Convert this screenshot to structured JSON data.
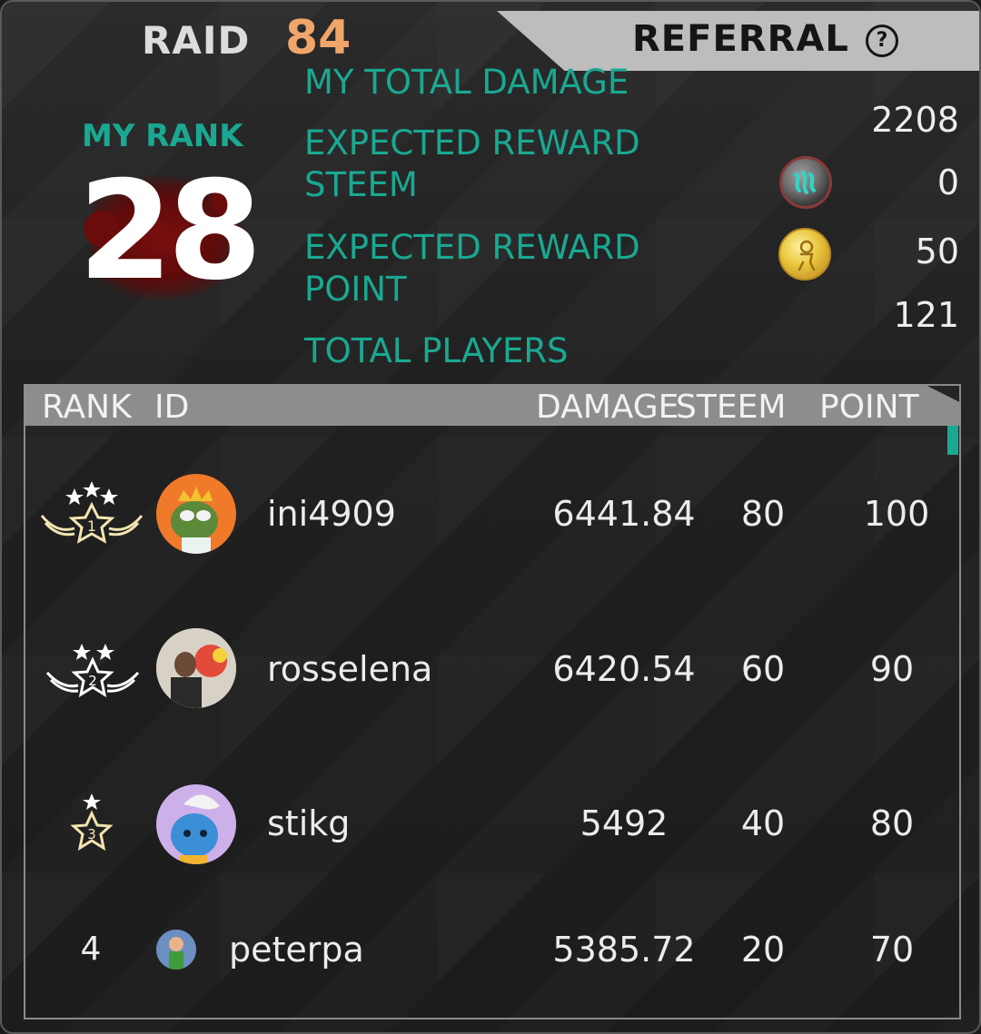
{
  "tabs": {
    "raid_label": "RAID",
    "raid_count": "84",
    "referral_label": "REFERRAL",
    "help_icon": "?"
  },
  "my_rank": {
    "label": "MY RANK",
    "value": "28"
  },
  "stats": {
    "total_damage_label": "MY TOTAL DAMAGE",
    "total_damage_value": "2208",
    "reward_steem_label_1": "EXPECTED REWARD",
    "reward_steem_label_2": "STEEM",
    "reward_steem_value": "0",
    "reward_point_label_1": "EXPECTED REWARD",
    "reward_point_label_2": "POINT",
    "reward_point_value": "50",
    "total_players_label": "TOTAL PLAYERS",
    "total_players_value": "121"
  },
  "icons": {
    "steem": "steem-coin-icon",
    "point": "point-coin-icon"
  },
  "colors": {
    "accent_teal": "#1aa892",
    "raid_orange": "#f0a66a",
    "header_gray": "#8d8d8d"
  },
  "table": {
    "headers": {
      "rank": "RANK",
      "id": "ID",
      "damage": "DAMAGE",
      "steem": "STEEM",
      "point": "POINT"
    },
    "rows": [
      {
        "rank": "1",
        "id": "ini4909",
        "damage": "6441.84",
        "steem": "80",
        "point": "100"
      },
      {
        "rank": "2",
        "id": "rosselena",
        "damage": "6420.54",
        "steem": "60",
        "point": "90"
      },
      {
        "rank": "3",
        "id": "stikg",
        "damage": "5492",
        "steem": "40",
        "point": "80"
      },
      {
        "rank": "4",
        "id": "peterpa",
        "damage": "5385.72",
        "steem": "20",
        "point": "70"
      }
    ]
  }
}
